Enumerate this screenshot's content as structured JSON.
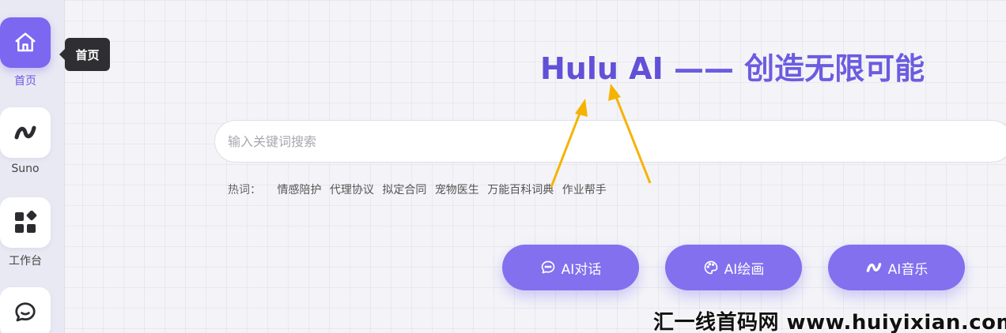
{
  "sidebar": {
    "items": [
      {
        "label": "首页",
        "icon": "home-icon",
        "active": true
      },
      {
        "label": "Suno",
        "icon": "music-note-icon"
      },
      {
        "label": "工作台",
        "icon": "grid-icon"
      },
      {
        "label": "",
        "icon": "chat-icon"
      }
    ]
  },
  "tooltip": {
    "text": "首页"
  },
  "hero": {
    "brand": "Hulu AI",
    "tagline": "—— 创造无限可能"
  },
  "search": {
    "placeholder": "输入关键词搜索",
    "value": ""
  },
  "hotwords": {
    "label": "热词：",
    "items": [
      "情感陪护",
      "代理协议",
      "拟定合同",
      "宠物医生",
      "万能百科词典",
      "作业帮手"
    ]
  },
  "actions": [
    {
      "label": "AI对话",
      "icon": "chat-bubble-icon"
    },
    {
      "label": "AI绘画",
      "icon": "palette-icon"
    },
    {
      "label": "AI音乐",
      "icon": "music-note-icon"
    }
  ],
  "watermark": {
    "text": "汇一线首码网 www.huiyixian.com"
  },
  "colors": {
    "accent": "#7b67f0",
    "button": "#8270ee",
    "arrow": "#f5b301",
    "tooltip": "#2f2f33"
  }
}
